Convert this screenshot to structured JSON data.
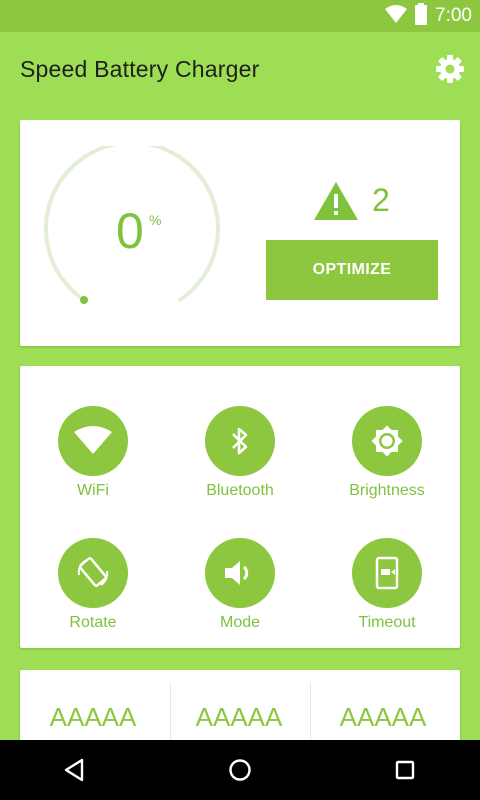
{
  "status_bar": {
    "time": "7:00",
    "icons": [
      "wifi-icon",
      "battery-icon"
    ]
  },
  "app": {
    "title": "Speed Battery Charger",
    "settings_icon": "gear-icon"
  },
  "battery": {
    "percent_value": "0",
    "percent_sign": "%",
    "level": 0,
    "warning_icon": "warning-icon",
    "warning_count": "2",
    "optimize_label": "OPTIMIZE"
  },
  "toggles": [
    {
      "label": "WiFi",
      "icon": "wifi-icon"
    },
    {
      "label": "Bluetooth",
      "icon": "bluetooth-icon"
    },
    {
      "label": "Brightness",
      "icon": "brightness-icon"
    },
    {
      "label": "Rotate",
      "icon": "rotate-icon"
    },
    {
      "label": "Mode",
      "icon": "volume-icon"
    },
    {
      "label": "Timeout",
      "icon": "timeout-icon"
    }
  ],
  "stats": [
    {
      "value": "AAAAA"
    },
    {
      "value": "AAAAA"
    },
    {
      "value": "AAAAA"
    }
  ],
  "nav": {
    "back_icon": "back-icon",
    "home_icon": "home-icon",
    "recents_icon": "recents-icon"
  },
  "colors": {
    "background": "#9ede54",
    "accent": "#8dc63f",
    "text_accent": "#7fc23e",
    "status_bar": "#8dc63f",
    "nav_bar": "#000000"
  }
}
